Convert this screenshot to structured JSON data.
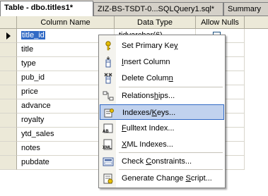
{
  "tabs": [
    {
      "label": "Table - dbo.titles1*",
      "active": true
    },
    {
      "label": "ZIZ-BS-TSDT-0...SQLQuery1.sql*",
      "active": false
    },
    {
      "label": "Summary",
      "active": false
    }
  ],
  "grid": {
    "headers": [
      "Column Name",
      "Data Type",
      "Allow Nulls"
    ],
    "rows": [
      {
        "name": "title_id",
        "type": "tidvarchar(6)"
      },
      {
        "name": "title",
        "type": ""
      },
      {
        "name": "type",
        "type": ""
      },
      {
        "name": "pub_id",
        "type": ""
      },
      {
        "name": "price",
        "type": ""
      },
      {
        "name": "advance",
        "type": ""
      },
      {
        "name": "royalty",
        "type": ""
      },
      {
        "name": "ytd_sales",
        "type": ""
      },
      {
        "name": "notes",
        "type": ""
      },
      {
        "name": "pubdate",
        "type": ""
      }
    ]
  },
  "context_menu": {
    "items": [
      {
        "pre": "Set Primary Ke",
        "key": "y",
        "post": "",
        "icon": "key-icon"
      },
      {
        "pre": "",
        "key": "I",
        "post": "nsert Column",
        "icon": "insert-column-icon"
      },
      {
        "pre": "Delete Colum",
        "key": "n",
        "post": "",
        "icon": "delete-column-icon"
      },
      {
        "pre": "Relations",
        "key": "h",
        "post": "ips...",
        "icon": "relationships-icon"
      },
      {
        "pre": "Indexes/",
        "key": "K",
        "post": "eys...",
        "icon": "indexes-keys-icon",
        "highlighted": true
      },
      {
        "pre": "",
        "key": "F",
        "post": "ulltext Index...",
        "icon": "fulltext-index-icon"
      },
      {
        "pre": "",
        "key": "X",
        "post": "ML Indexes...",
        "icon": "xml-indexes-icon"
      },
      {
        "pre": "Check ",
        "key": "C",
        "post": "onstraints...",
        "icon": "check-constraints-icon"
      },
      {
        "pre": "Generate Change ",
        "key": "S",
        "post": "cript...",
        "icon": "generate-script-icon"
      }
    ],
    "icon_badges": {
      "fulltext": "AB",
      "xml": "XML"
    }
  },
  "colors": {
    "highlight_fill": "#c1d2ee",
    "highlight_border": "#316ac5",
    "header_bg": "#ece9d8"
  }
}
